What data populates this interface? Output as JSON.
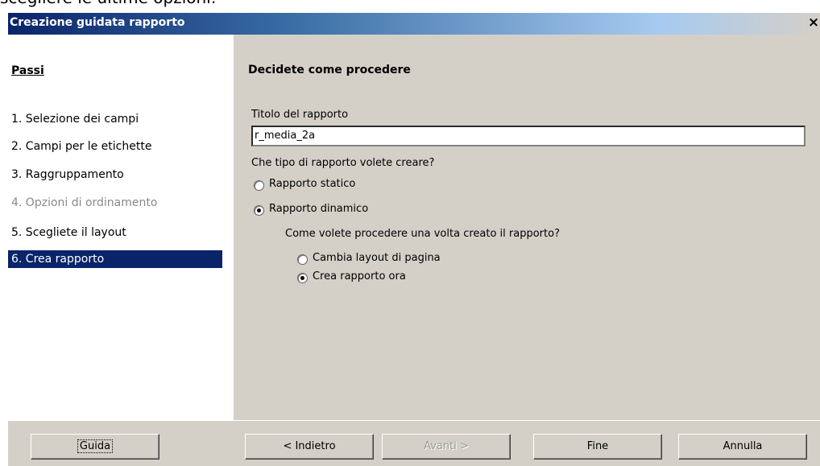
{
  "caption": "scegliere le ultime opzioni:",
  "window": {
    "title": "Creazione guidata rapporto",
    "close": "×"
  },
  "steps": {
    "title": "Passi",
    "items": [
      {
        "label": "1. Selezione dei campi",
        "state": "normal"
      },
      {
        "label": "2. Campi per le etichette",
        "state": "normal"
      },
      {
        "label": "3. Raggruppamento",
        "state": "normal"
      },
      {
        "label": "4. Opzioni di ordinamento",
        "state": "disabled"
      },
      {
        "label": "5. Scegliete il layout",
        "state": "normal"
      },
      {
        "label": "6. Crea rapporto",
        "state": "selected"
      }
    ]
  },
  "panel": {
    "title": "Decidete come procedere",
    "report_title_label": "Titolo del rapporto",
    "report_title_value": "r_media_2a",
    "type_question": "Che tipo di rapporto volete creare?",
    "static_option": "Rapporto statico",
    "dynamic_option": "Rapporto dinamico",
    "dynamic_question": "Come volete procedere una volta creato il rapporto?",
    "edit_layout_option": "Cambia layout di pagina",
    "create_now_option": "Crea rapporto ora"
  },
  "buttons": {
    "help": "Guida",
    "back": "< Indietro",
    "next": "Avanti >",
    "finish": "Fine",
    "cancel": "Annulla"
  }
}
